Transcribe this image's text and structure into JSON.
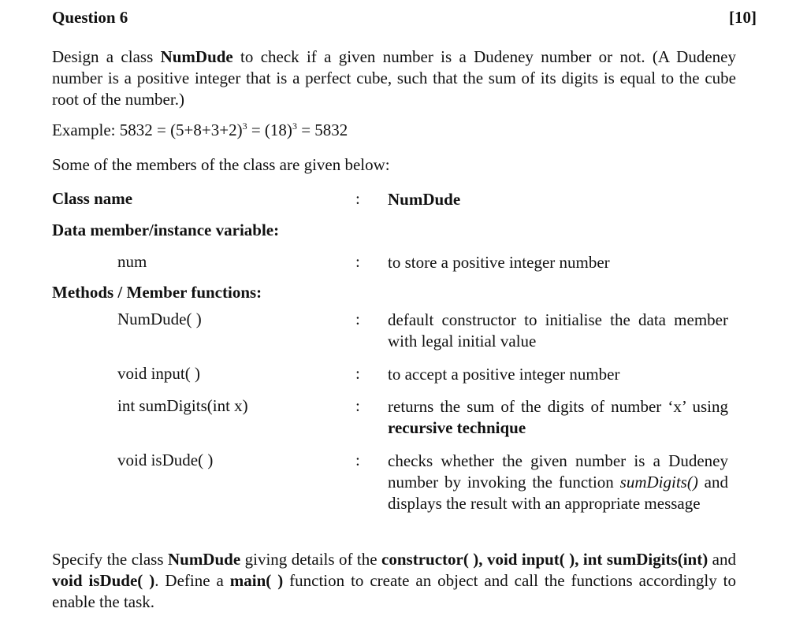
{
  "question": {
    "title": "Question 6",
    "marks": "[10]"
  },
  "intro": {
    "t1": "Design a class ",
    "class_name": "NumDude",
    "t2": " to check if a given number is a Dudeney number or not. (A Dudeney number is a positive integer that is a perfect cube, such that the sum of its digits is equal to the cube root of the number.)"
  },
  "example": {
    "a": "Example: 5832 = (5+8+3+2)",
    "p1": "3",
    "b": " = (18)",
    "p2": "3",
    "c": " = 5832"
  },
  "members_intro": "Some of the members of the class are given below:",
  "class_row": {
    "label": "Class name",
    "colon": ":",
    "value": "NumDude"
  },
  "data_heading": "Data member/instance variable:",
  "data_members": [
    {
      "name": "num",
      "colon": ":",
      "desc": "to store a positive integer number"
    }
  ],
  "methods_heading": "Methods / Member functions:",
  "methods": [
    {
      "name": "NumDude( )",
      "colon": ":",
      "desc": "default constructor to initialise the data member with legal initial value"
    },
    {
      "name": "void  input( )",
      "colon": ":",
      "desc": "to accept a positive integer number"
    },
    {
      "name": "int sumDigits(int x)",
      "colon": ":",
      "desc_a": "returns the sum of the digits of number ‘x’ using ",
      "desc_b": "recursive technique"
    },
    {
      "name": "void isDude( )",
      "colon": ":",
      "desc_a": "checks whether the given number is a Dudeney number by invoking the function ",
      "desc_i": "sumDigits()",
      "desc_b": " and displays the result with an appropriate message"
    }
  ],
  "specify": {
    "s1": "Specify the class ",
    "s2": "NumDude",
    "s3": " giving details of the ",
    "s4": "constructor( ), void input( ), int sumDigits(int)",
    "s5": " and ",
    "s6": "void isDude( )",
    "s7": ". Define a ",
    "s8": "main( )",
    "s9": " function to create an object and call the functions accordingly to enable the task."
  }
}
